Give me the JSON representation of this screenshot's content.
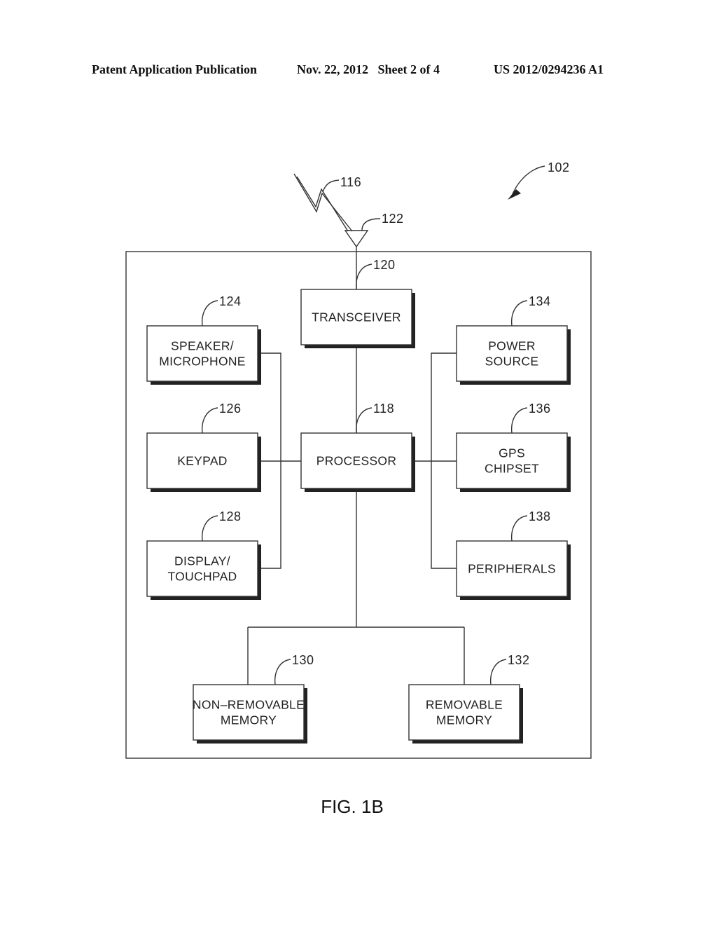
{
  "header": {
    "publication": "Patent Application Publication",
    "date_sheet": "Nov. 22, 2012   Sheet 2 of 4",
    "number": "US 2012/0294236 A1"
  },
  "figure": {
    "caption": "FIG. 1B",
    "device_ref": "102",
    "signal_ref": "116",
    "antenna_ref": "122",
    "blocks": {
      "transceiver": {
        "ref": "120",
        "lines": [
          "TRANSCEIVER"
        ]
      },
      "speaker": {
        "ref": "124",
        "lines": [
          "SPEAKER/",
          "MICROPHONE"
        ]
      },
      "keypad": {
        "ref": "126",
        "lines": [
          "KEYPAD"
        ]
      },
      "display": {
        "ref": "128",
        "lines": [
          "DISPLAY/",
          "TOUCHPAD"
        ]
      },
      "processor": {
        "ref": "118",
        "lines": [
          "PROCESSOR"
        ]
      },
      "power": {
        "ref": "134",
        "lines": [
          "POWER",
          "SOURCE"
        ]
      },
      "gps": {
        "ref": "136",
        "lines": [
          "GPS",
          "CHIPSET"
        ]
      },
      "peripherals": {
        "ref": "138",
        "lines": [
          "PERIPHERALS"
        ]
      },
      "nonremovable": {
        "ref": "130",
        "lines": [
          "NON–REMOVABLE",
          "MEMORY"
        ]
      },
      "removable": {
        "ref": "132",
        "lines": [
          "REMOVABLE",
          "MEMORY"
        ]
      }
    }
  }
}
